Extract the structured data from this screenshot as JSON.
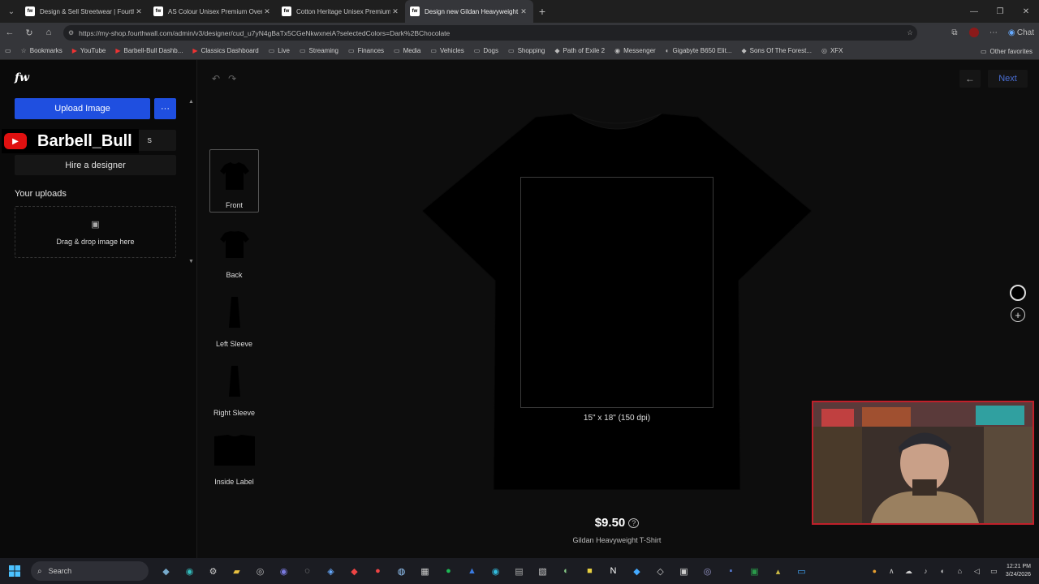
{
  "browser": {
    "tabs": [
      {
        "title": "Design & Sell Streetwear | Fourthw",
        "active": false
      },
      {
        "title": "AS Colour Unisex Premium Overs",
        "active": false
      },
      {
        "title": "Cotton Heritage Unisex Premium",
        "active": false
      },
      {
        "title": "Design new Gildan Heavyweight T-",
        "active": true
      }
    ],
    "favicon_text": "fw",
    "url": "https://my-shop.fourthwall.com/admin/v3/designer/cud_u7yN4gBaTx5CGeNkwxneiA?selectedColors=Dark%2BChocolate",
    "chat_label": "Chat",
    "bookmarks": [
      {
        "label": "Bookmarks",
        "icon": "bookmarks-icon"
      },
      {
        "label": "YouTube",
        "icon": "youtube-icon"
      },
      {
        "label": "Barbell-Bull Dashb...",
        "icon": "youtube-icon"
      },
      {
        "label": "Classics Dashboard",
        "icon": "youtube-icon"
      },
      {
        "label": "Live",
        "icon": "folder-icon"
      },
      {
        "label": "Streaming",
        "icon": "folder-icon"
      },
      {
        "label": "Finances",
        "icon": "folder-icon"
      },
      {
        "label": "Media",
        "icon": "folder-icon"
      },
      {
        "label": "Vehicles",
        "icon": "folder-icon"
      },
      {
        "label": "Dogs",
        "icon": "folder-icon"
      },
      {
        "label": "Shopping",
        "icon": "folder-icon"
      },
      {
        "label": "Path of Exile 2",
        "icon": "game-icon"
      },
      {
        "label": "Messenger",
        "icon": "messenger-icon"
      },
      {
        "label": "Gigabyte B650 Elit...",
        "icon": "gigabyte-icon"
      },
      {
        "label": "Sons Of The Forest...",
        "icon": "game-icon"
      },
      {
        "label": "XFX",
        "icon": "globe-icon"
      }
    ],
    "other_favorites": "Other favorites"
  },
  "designer": {
    "logo": "fw",
    "upload_button": "Upload Image",
    "ai_button_visible_text": "s",
    "hire_button": "Hire a designer",
    "uploads_heading": "Your uploads",
    "dropzone_text": "Drag & drop image here",
    "overlay_name": "Barbell_Bull",
    "views": [
      {
        "label": "Front",
        "selected": true
      },
      {
        "label": "Back",
        "selected": false
      },
      {
        "label": "Left Sleeve",
        "selected": false
      },
      {
        "label": "Right Sleeve",
        "selected": false
      },
      {
        "label": "Inside Label",
        "selected": false
      }
    ],
    "print_dimensions": "15\" x 18\" (150 dpi)",
    "next_button": "Next",
    "price": "$9.50",
    "product_name": "Gildan Heavyweight T-Shirt",
    "selected_color": "#000000"
  },
  "taskbar": {
    "search_label": "Search",
    "time": "12:21 PM",
    "date": "3/24/2026"
  }
}
